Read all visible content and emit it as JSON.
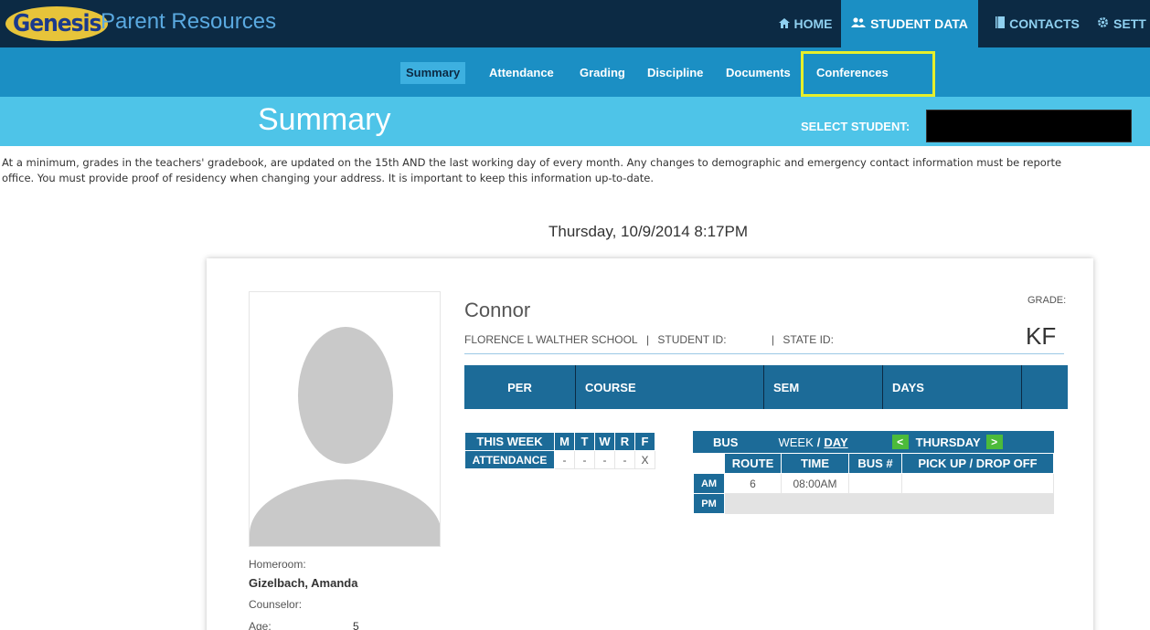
{
  "header": {
    "logo_text": "Genesis",
    "app_title": "Parent Resources",
    "nav": [
      {
        "label": "HOME",
        "icon": "home-icon"
      },
      {
        "label": "STUDENT DATA",
        "icon": "users-icon"
      },
      {
        "label": "CONTACTS",
        "icon": "book-icon"
      },
      {
        "label": "SETT",
        "icon": "gear-icon"
      }
    ]
  },
  "subnav": {
    "items": [
      "Summary",
      "Attendance",
      "Grading",
      "Discipline",
      "Documents",
      "Conferences"
    ],
    "active": "Summary"
  },
  "titleband": {
    "title": "Summary",
    "select_label": "SELECT STUDENT:"
  },
  "notice": {
    "line1": "At a minimum, grades in the teachers' gradebook, are updated on the 15th AND the last working day of every month. Any changes to demographic and emergency contact information must be reporte",
    "line2": "office. You must provide proof of residency when changing your address. It is important to keep this information up-to-date."
  },
  "datetime": "Thursday, 10/9/2014 8:17PM",
  "student": {
    "name": "Connor",
    "school": "FLORENCE L WALTHER SCHOOL",
    "student_id_label": "STUDENT ID:",
    "state_id_label": "STATE ID:",
    "grade_label": "GRADE:",
    "grade": "KF",
    "homeroom_label": "Homeroom:",
    "homeroom": "Gizelbach, Amanda",
    "counselor_label": "Counselor:",
    "age_label": "Age:",
    "age": "5"
  },
  "schedule": {
    "headers": [
      "PER",
      "COURSE",
      "SEM",
      "DAYS",
      ""
    ]
  },
  "week": {
    "header": "THIS WEEK",
    "days": [
      "M",
      "T",
      "W",
      "R",
      "F"
    ],
    "row_label": "ATTENDANCE",
    "values": [
      "-",
      "-",
      "-",
      "-",
      "X"
    ]
  },
  "bus": {
    "title": "BUS",
    "toggle_week": "WEEK",
    "toggle_sep": "/",
    "toggle_day": "DAY",
    "prev": "<",
    "next": ">",
    "day": "THURSDAY",
    "columns": [
      "ROUTE",
      "TIME",
      "BUS #",
      "PICK UP / DROP OFF"
    ],
    "am_label": "AM",
    "am": {
      "route": "6",
      "time": "08:00AM",
      "bus": "",
      "stop": ""
    },
    "pm_label": "PM"
  },
  "colors": {
    "topbar": "#0c2a44",
    "subnav": "#1b8fc4",
    "titleband": "#4ec4e8",
    "table_header": "#1c6b98",
    "highlight": "#e6ef2b",
    "arrow": "#4cbb3a"
  }
}
